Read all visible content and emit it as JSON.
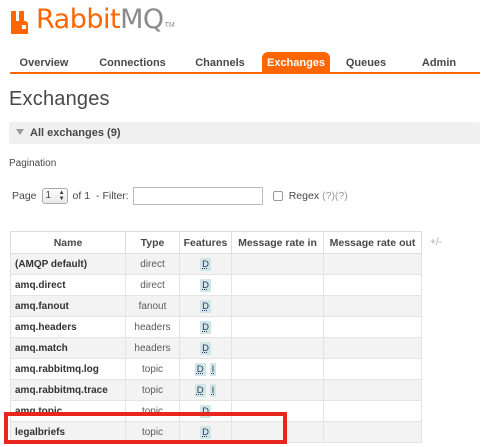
{
  "logo": {
    "rabbit": "Rabbit",
    "mq": "MQ",
    "tm": "TM"
  },
  "tabs": [
    {
      "label": "Overview",
      "active": false
    },
    {
      "label": "Connections",
      "active": false
    },
    {
      "label": "Channels",
      "active": false
    },
    {
      "label": "Exchanges",
      "active": true
    },
    {
      "label": "Queues",
      "active": false
    },
    {
      "label": "Admin",
      "active": false
    }
  ],
  "page_title": "Exchanges",
  "section": {
    "label": "All exchanges (9)"
  },
  "pagination": {
    "label": "Pagination",
    "page_label": "Page",
    "page_value": "1",
    "of_label": "of 1",
    "filter_label": "- Filter:",
    "filter_value": "",
    "regex_label": "Regex",
    "regex_help": "(?)(?)"
  },
  "table": {
    "columns": [
      "Name",
      "Type",
      "Features",
      "Message rate in",
      "Message rate out"
    ],
    "add_remove": "+/-",
    "rows": [
      {
        "name": "(AMQP default)",
        "type": "direct",
        "features": [
          "D"
        ]
      },
      {
        "name": "amq.direct",
        "type": "direct",
        "features": [
          "D"
        ]
      },
      {
        "name": "amq.fanout",
        "type": "fanout",
        "features": [
          "D"
        ]
      },
      {
        "name": "amq.headers",
        "type": "headers",
        "features": [
          "D"
        ]
      },
      {
        "name": "amq.match",
        "type": "headers",
        "features": [
          "D"
        ]
      },
      {
        "name": "amq.rabbitmq.log",
        "type": "topic",
        "features": [
          "D",
          "I"
        ]
      },
      {
        "name": "amq.rabbitmq.trace",
        "type": "topic",
        "features": [
          "D",
          "I"
        ]
      },
      {
        "name": "amq.topic",
        "type": "topic",
        "features": [
          "D"
        ]
      },
      {
        "name": "legalbriefs",
        "type": "topic",
        "features": [
          "D"
        ]
      }
    ]
  },
  "colors": {
    "accent": "#ff6600",
    "highlight": "#e8261d",
    "badge": "#cfe8e6"
  }
}
